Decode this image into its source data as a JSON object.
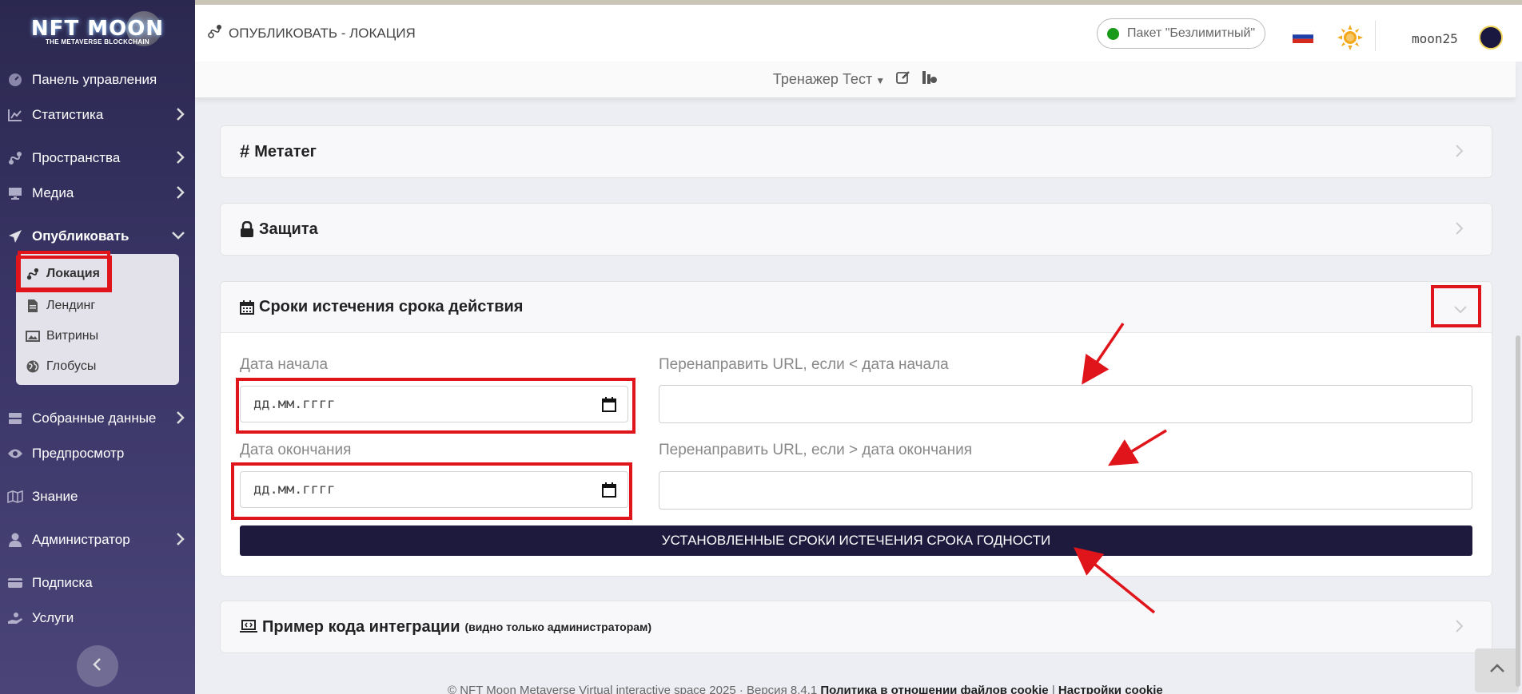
{
  "logo": {
    "title": "NFT MOON",
    "subtitle": "THE METAVERSE BLOCKCHAIN"
  },
  "sidebar": {
    "items": [
      {
        "label": "Панель управления",
        "icon": "dashboard-icon"
      },
      {
        "label": "Статистика",
        "icon": "chart-icon"
      },
      {
        "label": "Пространства",
        "icon": "route-icon"
      },
      {
        "label": "Медиа",
        "icon": "monitor-icon"
      },
      {
        "label": "Опубликовать",
        "icon": "paper-plane-icon"
      },
      {
        "label": "Собранные данные",
        "icon": "database-icon"
      },
      {
        "label": "Предпросмотр",
        "icon": "eye-icon"
      },
      {
        "label": "Знание",
        "icon": "map-icon"
      },
      {
        "label": "Администратор",
        "icon": "user-icon"
      },
      {
        "label": "Подписка",
        "icon": "card-icon"
      },
      {
        "label": "Услуги",
        "icon": "hand-icon"
      }
    ],
    "publish_sub": [
      {
        "label": "Локация",
        "icon": "route-icon"
      },
      {
        "label": "Лендинг",
        "icon": "file-icon"
      },
      {
        "label": "Витрины",
        "icon": "image-icon"
      },
      {
        "label": "Глобусы",
        "icon": "globe-icon"
      }
    ]
  },
  "header": {
    "title": "ОПУБЛИКОВАТЬ - ЛОКАЦИЯ",
    "package": "Пакет \"Безлимитный\"",
    "package_status_color": "#1a9a1a",
    "username": "moon25"
  },
  "subbar": {
    "project": "Тренажер Тест"
  },
  "cards": {
    "metatag": "Метатег",
    "protection": "Защита",
    "expiry": "Сроки истечения срока действия",
    "integration": "Пример кода интеграции",
    "integration_note": "(видно только администраторам)"
  },
  "form": {
    "start_label": "Дата начала",
    "start_placeholder": "дд.мм.гггг",
    "end_label": "Дата окончания",
    "end_placeholder": "дд.мм.гггг",
    "redirect_before_label": "Перенаправить URL, если < дата начала",
    "redirect_after_label": "Перенаправить URL, если > дата окончания",
    "submit": "УСТАНОВЛЕННЫЕ СРОКИ ИСТЕЧЕНИЯ СРОКА ГОДНОСТИ"
  },
  "footer": {
    "copyright": "© NFT Moon Metaverse Virtual interactive space 2025 · Версия 8.4.1",
    "cookie_policy": "Политика в отношении файлов cookie",
    "cookie_settings": "Настройки cookie"
  },
  "colors": {
    "accent_dark": "#1e1a3e",
    "highlight_red": "#e0151b",
    "sidebar": "#2b2850"
  }
}
